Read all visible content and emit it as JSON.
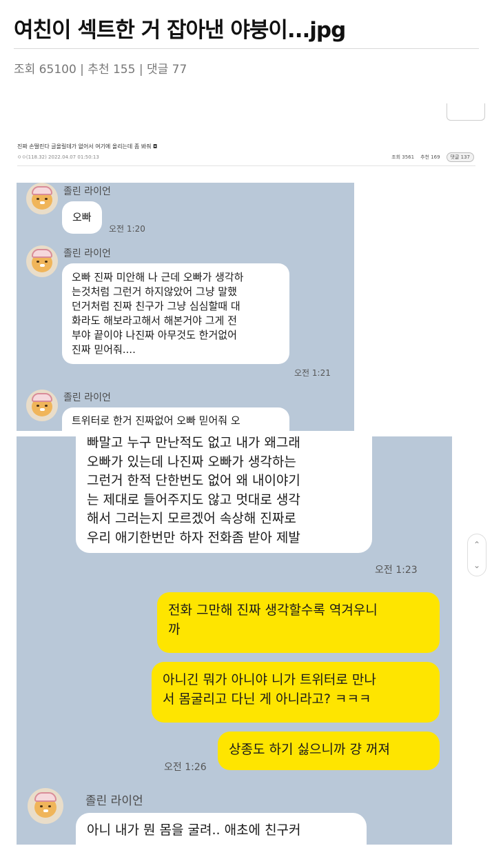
{
  "post": {
    "title": "여친이 섹트한 거 잡아낸 야붕이...jpg",
    "meta": "조회 65100 | 추천 155 | 댓글 77"
  },
  "embedded_post": {
    "title": "진짜 손떨린다 글올릴데가 없어서 여기에 올리는데 좀 봐줘 ◘",
    "author_line": "ㅇㅇ(118.32)   2022.04.07 01:50:13",
    "views": "조회 3561",
    "recommends": "추천 169",
    "comments": "댓글 137"
  },
  "chat1": {
    "messages": [
      {
        "sender": "졸린 라이언",
        "text": "오빠",
        "time": "오전 1:20"
      },
      {
        "sender": "졸린 라이언",
        "text": "오빠 진짜 미안해 나 근데 오빠가 생각하\n는것처럼 그런거 하지않았어 그냥 말했\n던거처럼 진짜 친구가 그냥 심심할때 대\n화라도 해보라고해서 해본거야 그게 전\n부야 끝이야 나진짜 아무것도 한거없어\n진짜 믿어줘....",
        "time": "오전 1:21"
      },
      {
        "sender": "졸린 라이언",
        "text": "트위터로 한거 진짜없어 오빠 믿어줘 오"
      }
    ]
  },
  "chat2": {
    "continued_text": "빠말고 누구 만난적도 없고 내가 왜그래\n오빠가 있는데 나진짜 오빠가 생각하는\n그런거 한적 단한번도 없어 왜 내이야기\n는 제대로 들어주지도 않고 멋대로 생각\n해서 그러는지 모르겠어 속상해 진짜로\n우리 애기한번만 하자 전화좀 받아 제발",
    "continued_time": "오전 1:23",
    "sent": [
      {
        "text": "전화 그만해 진짜 생각할수록 역겨우니\n까"
      },
      {
        "text": "아니긴 뭐가 아니야 니가 트위터로 만나\n서 몸굴리고 다닌 게 아니라고? ㅋㅋㅋ"
      },
      {
        "text": "상종도 하기 싫으니까 걍 꺼져"
      }
    ],
    "sent_time": "오전 1:26",
    "last": {
      "sender": "졸린 라이언",
      "text": "아니 내가 뭔 몸을 굴려.. 애초에 친구커"
    }
  },
  "scroll": {
    "up": "⌃",
    "down": "⌄"
  },
  "colors": {
    "chat_bg": "#b9c8d8",
    "sent_bubble": "#fee500",
    "recv_bubble": "#ffffff"
  }
}
